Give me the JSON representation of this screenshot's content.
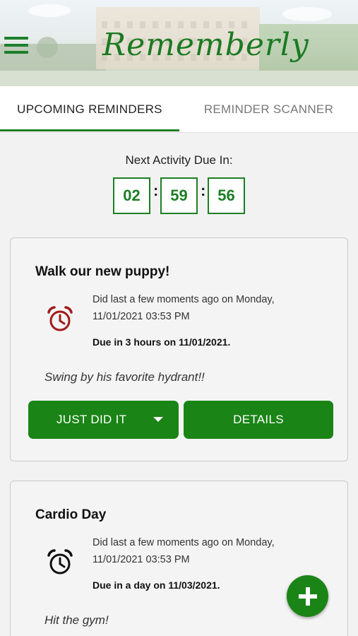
{
  "header": {
    "app_title": "Rememberly",
    "menu_icon": "hamburger-menu-icon"
  },
  "tabs": [
    {
      "label": "UPCOMING REMINDERS",
      "active": true
    },
    {
      "label": "REMINDER SCANNER",
      "active": false
    }
  ],
  "timer": {
    "label": "Next Activity Due In:",
    "hours": "02",
    "minutes": "59",
    "seconds": "56",
    "separator": ":"
  },
  "reminders": [
    {
      "title": "Walk our new puppy!",
      "icon": "alarm-clock-icon",
      "icon_color": "#a11a1a",
      "last_done": "Did last a few moments ago on Monday, 11/01/2021 03:53 PM",
      "due": "Due in 3 hours on 11/01/2021.",
      "note": "Swing by his favorite hydrant!!",
      "primary_button": "JUST DID IT",
      "secondary_button": "DETAILS"
    },
    {
      "title": "Cardio Day",
      "icon": "alarm-clock-icon",
      "icon_color": "#111111",
      "last_done": "Did last a few moments ago on Monday, 11/01/2021 03:53 PM",
      "due": "Due in a day on 11/03/2021.",
      "note": "Hit the gym!"
    }
  ],
  "fab": {
    "icon": "plus-icon"
  },
  "colors": {
    "brand_green": "#1a8416",
    "accent_text_green": "#1c7f24",
    "overdue_red": "#a11a1a",
    "background": "#f2f2f2"
  }
}
